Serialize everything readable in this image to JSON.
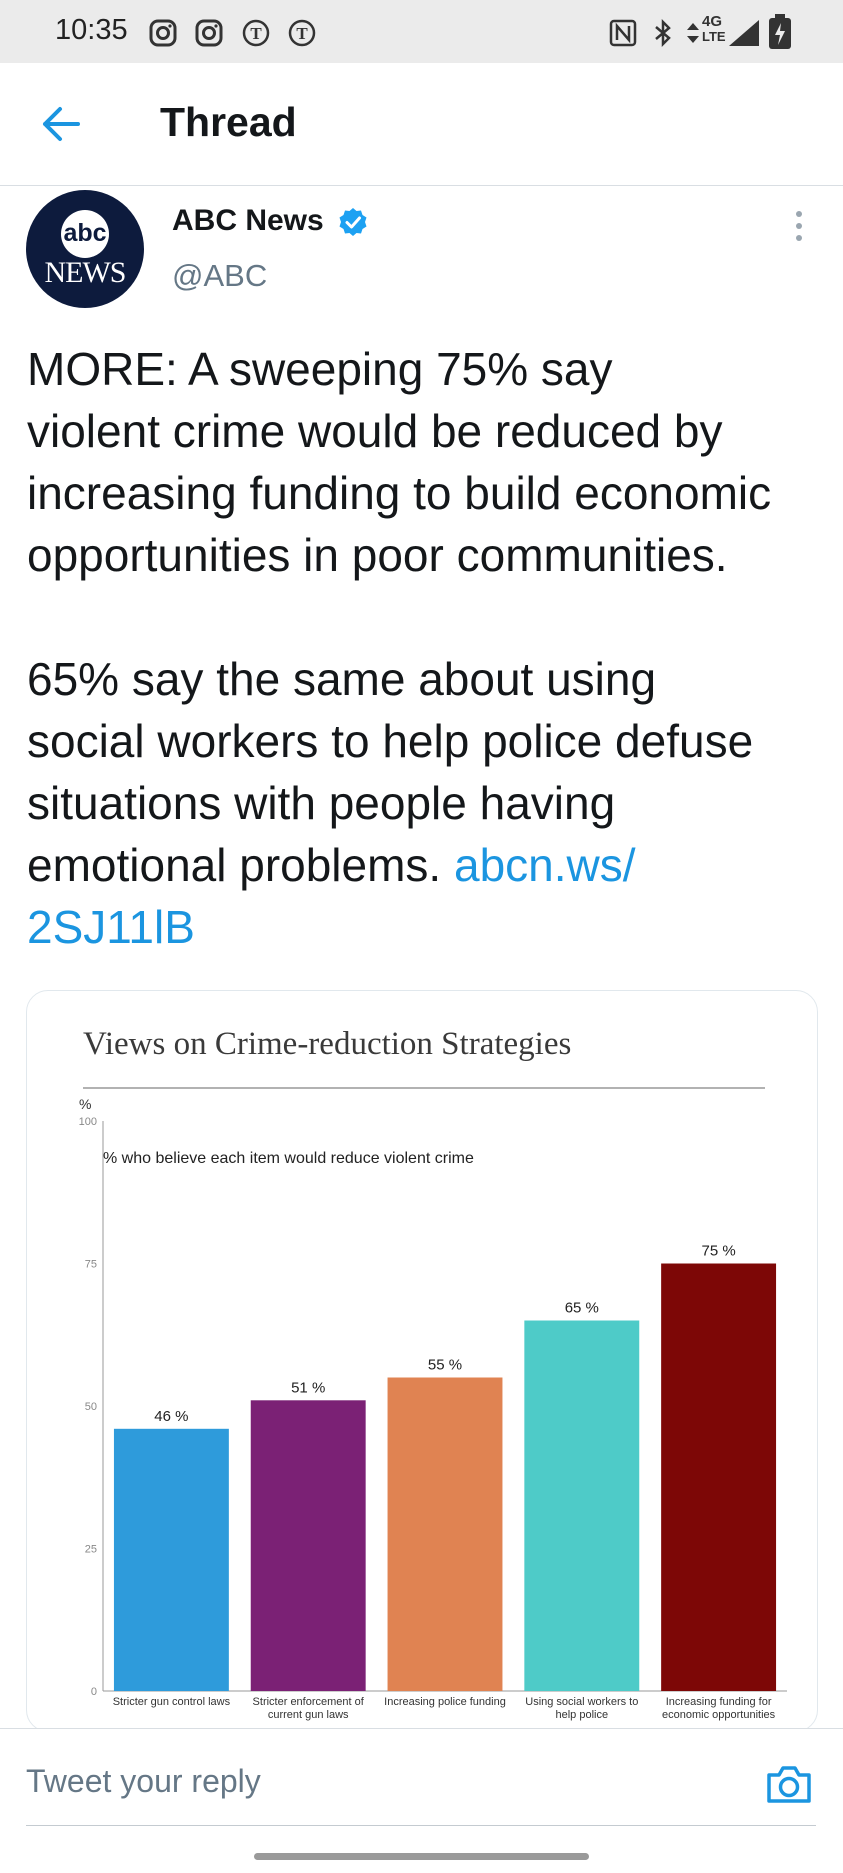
{
  "status_bar": {
    "time": "10:35",
    "network": "4G",
    "network_sub": "LTE",
    "icons": [
      "instagram-icon",
      "instagram-icon",
      "nytimes-icon",
      "nytimes-icon",
      "nfc-icon",
      "bluetooth-icon",
      "signal-icon",
      "battery-icon"
    ]
  },
  "header": {
    "title": "Thread",
    "back_icon": "arrow-left-icon"
  },
  "tweet": {
    "avatar_top": "abc",
    "avatar_bottom": "NEWS",
    "author_name": "ABC News",
    "handle": "@ABC",
    "text": "MORE: A sweeping 75% say\nviolent crime would be reduced by\nincreasing funding to build economic\nopportunities in poor communities.\n\n65% say the same about using\nsocial workers to help police defuse\nsituations with people having\nemotional problems. ",
    "link_part1": "abcn.ws/",
    "link_part2": "2SJ11lB"
  },
  "chart_data": {
    "type": "bar",
    "title": "Views on Crime-reduction Strategies",
    "subtitle": "% who believe each item would reduce violent crime",
    "ylabel": "%",
    "ylim": [
      0,
      100
    ],
    "yticks": [
      0,
      25,
      50,
      75,
      100
    ],
    "categories": [
      "Stricter gun control laws",
      "Stricter enforcement of current gun laws",
      "Increasing police funding",
      "Using social workers to help police",
      "Increasing funding for economic opportunities"
    ],
    "category_lines": [
      [
        "Stricter gun control laws"
      ],
      [
        "Stricter enforcement of",
        "current gun laws"
      ],
      [
        "Increasing police funding"
      ],
      [
        "Using social workers to",
        "help police"
      ],
      [
        "Increasing funding for",
        "economic opportunities"
      ]
    ],
    "values": [
      46,
      51,
      55,
      65,
      75
    ],
    "value_labels": [
      "46 %",
      "51 %",
      "55 %",
      "65 %",
      "75 %"
    ],
    "colors": [
      "#2e9bdb",
      "#7b2175",
      "#e08352",
      "#4ecbc8",
      "#7d0706"
    ]
  },
  "reply": {
    "placeholder": "Tweet your reply",
    "camera_icon": "camera-icon"
  },
  "colors": {
    "accent": "#1b95e0",
    "text": "#14171a",
    "muted": "#657786"
  }
}
